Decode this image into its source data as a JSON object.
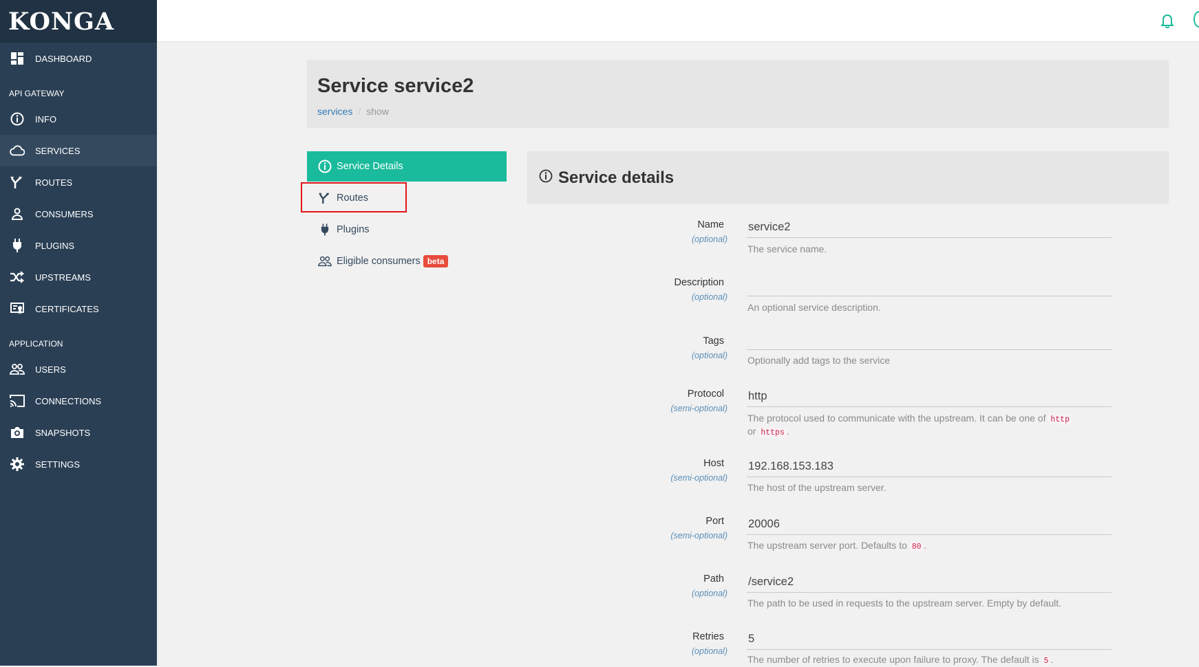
{
  "brand": "KONGA",
  "sidebar": {
    "dashboard": "DASHBOARD",
    "api_gateway_header": "API GATEWAY",
    "application_header": "APPLICATION",
    "items": {
      "info": "INFO",
      "services": "SERVICES",
      "routes": "ROUTES",
      "consumers": "CONSUMERS",
      "plugins": "PLUGINS",
      "upstreams": "UPSTREAMS",
      "certificates": "CERTIFICATES",
      "users": "USERS",
      "connections": "CONNECTIONS",
      "snapshots": "SNAPSHOTS",
      "settings": "SETTINGS"
    }
  },
  "header": {
    "title": "Service service2",
    "breadcrumb": {
      "link": "services",
      "separator": "/",
      "current": "show"
    }
  },
  "tabs": {
    "service_details": "Service Details",
    "routes": "Routes",
    "plugins": "Plugins",
    "eligible_consumers": "Eligible consumers",
    "beta_badge": "beta"
  },
  "details": {
    "title": "Service details",
    "fields": {
      "name": {
        "label": "Name",
        "qualifier": "(optional)",
        "value": "service2",
        "help": "The service name."
      },
      "description": {
        "label": "Description",
        "qualifier": "(optional)",
        "value": "",
        "help": "An optional service description."
      },
      "tags": {
        "label": "Tags",
        "qualifier": "(optional)",
        "value": "",
        "help": "Optionally add tags to the service"
      },
      "protocol": {
        "label": "Protocol",
        "qualifier": "(semi-optional)",
        "value": "http",
        "help_a": "The protocol used to communicate with the upstream. It can be one of",
        "code_a": "http",
        "help_b": "or",
        "code_b": "https",
        "help_c": "."
      },
      "host": {
        "label": "Host",
        "qualifier": "(semi-optional)",
        "value": "192.168.153.183",
        "help": "The host of the upstream server."
      },
      "port": {
        "label": "Port",
        "qualifier": "(semi-optional)",
        "value": "20006",
        "help_a": "The upstream server port. Defaults to",
        "code": "80",
        "help_b": "."
      },
      "path": {
        "label": "Path",
        "qualifier": "(optional)",
        "value": "/service2",
        "help": "The path to be used in requests to the upstream server. Empty by default."
      },
      "retries": {
        "label": "Retries",
        "qualifier": "(optional)",
        "value": "5",
        "help_a": "The number of retries to execute upon failure to proxy. The default is",
        "code": "5",
        "help_b": "."
      }
    }
  },
  "colors": {
    "sidebar_bg": "#2a3f54",
    "brand_bg": "#203243",
    "accent": "#1abb9c",
    "badge_red": "#e74c3c",
    "highlight_border": "#e0141a"
  }
}
